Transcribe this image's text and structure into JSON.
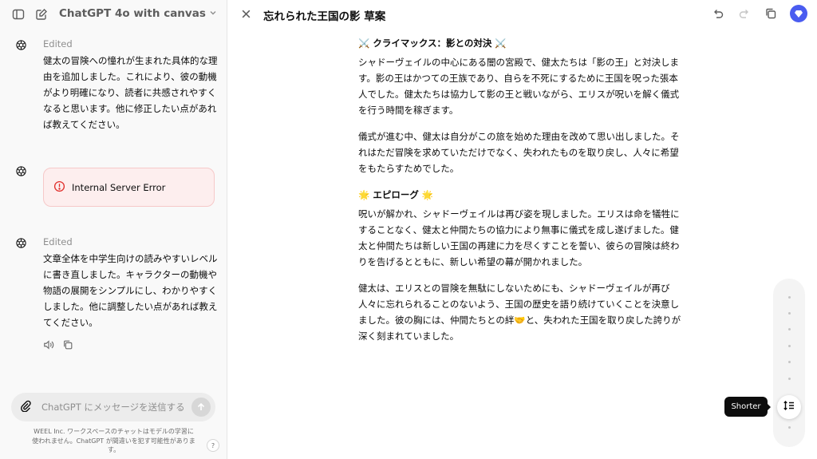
{
  "sidebar_header": {
    "model_title": "ChatGPT 4o with canvas",
    "toggle_sidebar_icon": "sidebar-toggle-icon",
    "new_chat_icon": "edit-icon",
    "dropdown_icon": "chevron-down-icon"
  },
  "messages": [
    {
      "status": "Edited",
      "text": "健太の冒険への憧れが生まれた具体的な理由を追加しました。これにより、彼の動機がより明確になり、読者に共感されやすくなると思います。他に修正したい点があれば教えてください。"
    },
    {
      "error": "Internal Server Error"
    },
    {
      "status": "Edited",
      "text": "文章全体を中学生向けの読みやすいレベルに書き直しました。キャラクターの動機や物語の展開をシンプルにし、わかりやすくしました。他に調整したい点があれば教えてください。"
    }
  ],
  "composer": {
    "placeholder": "ChatGPT にメッセージを送信する",
    "footer_note": "WEEL Inc. ワークスペースのチャットはモデルの学習に使われません。ChatGPT が間違いを犯す可能性があります。",
    "help_label": "?"
  },
  "canvas": {
    "title": "忘れられた王国の影 草案",
    "sections": [
      {
        "heading": "⚔️ クライマックス：影との対決 ⚔️",
        "paragraphs": [
          "シャドーヴェイルの中心にある闇の宮殿で、健太たちは「影の王」と対決します。影の王はかつての王族であり、自らを不死にするために王国を呪った張本人でした。健太たちは協力して影の王と戦いながら、エリスが呪いを解く儀式を行う時間を稼ぎます。",
          "儀式が進む中、健太は自分がこの旅を始めた理由を改めて思い出しました。それはただ冒険を求めていただけでなく、失われたものを取り戻し、人々に希望をもたらすためでした。"
        ]
      },
      {
        "heading": "🌟 エピローグ 🌟",
        "paragraphs": [
          "呪いが解かれ、シャドーヴェイルは再び姿を現しました。エリスは命を犠牲にすることなく、健太と仲間たちの協力により無事に儀式を成し遂げました。健太と仲間たちは新しい王国の再建に力を尽くすことを誓い、彼らの冒険は終わりを告げるとともに、新しい希望の幕が開かれました。",
          "健太は、エリスとの冒険を無駄にしないためにも、シャドーヴェイルが再び人々に忘れられることのないよう、王国の歴史を語り続けていくことを決意しました。彼の胸には、仲間たちとの絆🤝と、失われた王国を取り戻した誇りが深く刻まれていました。"
        ]
      }
    ]
  },
  "length_tool": {
    "tooltip": "Shorter",
    "level": 0.15
  },
  "colors": {
    "accent": "#4a5cf0",
    "error_bg": "#fdeeee",
    "error_icon": "#e02e2a"
  }
}
